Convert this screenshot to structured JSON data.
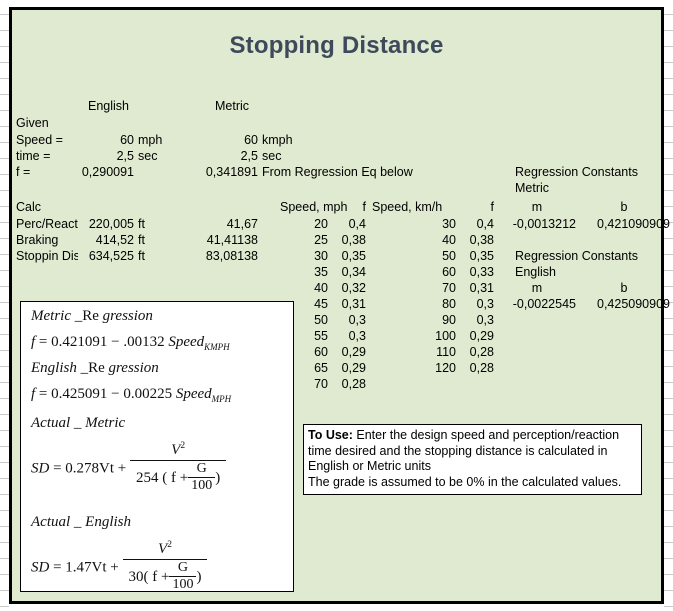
{
  "title": "Stopping Distance",
  "colors": {
    "panel_background": "#dfead0",
    "panel_border": "#000000",
    "title_text": "#3e4a5c",
    "box_background": "#ffffff"
  },
  "headers": {
    "english": "English",
    "metric": "Metric"
  },
  "given": {
    "section_label": "Given",
    "rows": [
      {
        "label": "Speed =",
        "english_value": "60",
        "english_unit": "mph",
        "metric_value": "60",
        "metric_unit": "kmph"
      },
      {
        "label": "time =",
        "english_value": "2,5",
        "english_unit": "sec",
        "metric_value": "2,5",
        "metric_unit": "sec"
      },
      {
        "label": "f =",
        "english_value": "0,290091",
        "english_unit": "",
        "metric_value": "0,341891",
        "metric_unit": "From Regression Eq below"
      }
    ]
  },
  "calc": {
    "section_label": "Calc",
    "rows": [
      {
        "label": "Perc/React",
        "english_value": "220,005",
        "english_unit": "ft",
        "metric_value": "41,67"
      },
      {
        "label": "Braking",
        "english_value": "414,52",
        "english_unit": "ft",
        "metric_value": "41,41138"
      },
      {
        "label": "Stoppin Dist",
        "english_value": "634,525",
        "english_unit": "ft",
        "metric_value": "83,08138"
      }
    ]
  },
  "table_mph": {
    "header_speed": "Speed, mph",
    "header_f": "f",
    "rows": [
      {
        "speed": "20",
        "f": "0,4"
      },
      {
        "speed": "25",
        "f": "0,38"
      },
      {
        "speed": "30",
        "f": "0,35"
      },
      {
        "speed": "35",
        "f": "0,34"
      },
      {
        "speed": "40",
        "f": "0,32"
      },
      {
        "speed": "45",
        "f": "0,31"
      },
      {
        "speed": "50",
        "f": "0,3"
      },
      {
        "speed": "55",
        "f": "0,3"
      },
      {
        "speed": "60",
        "f": "0,29"
      },
      {
        "speed": "65",
        "f": "0,29"
      },
      {
        "speed": "70",
        "f": "0,28"
      }
    ]
  },
  "table_kmh": {
    "header_speed": "Speed, km/h",
    "header_f": "f",
    "rows": [
      {
        "speed": "30",
        "f": "0,4"
      },
      {
        "speed": "40",
        "f": "0,38"
      },
      {
        "speed": "50",
        "f": "0,35"
      },
      {
        "speed": "60",
        "f": "0,33"
      },
      {
        "speed": "70",
        "f": "0,31"
      },
      {
        "speed": "80",
        "f": "0,3"
      },
      {
        "speed": "90",
        "f": "0,3"
      },
      {
        "speed": "100",
        "f": "0,29"
      },
      {
        "speed": "110",
        "f": "0,28"
      },
      {
        "speed": "120",
        "f": "0,28"
      }
    ]
  },
  "regression_metric": {
    "title": "Regression Constants",
    "subtitle": "Metric",
    "header_m": "m",
    "header_b": "b",
    "m": "-0,0013212",
    "b": "0,421090909"
  },
  "regression_english": {
    "title": "Regression Constants",
    "subtitle": "English",
    "header_m": "m",
    "header_b": "b",
    "m": "-0,0022545",
    "b": "0,425090909"
  },
  "formulas": {
    "metric_regression_title_italic": "Metric",
    "metric_regression_title_rest": "_Re",
    "metric_regression_title_tail": "gression",
    "metric_regression_eq_lhs": "f",
    "metric_regression_eq_rhs": "= 0.421091 − .00132",
    "metric_regression_eq_var": "Speed",
    "metric_regression_eq_sub": "KMPH",
    "english_regression_title_italic": "English",
    "english_regression_title_rest": "_Re",
    "english_regression_title_tail": "gression",
    "english_regression_eq_lhs": "f",
    "english_regression_eq_rhs": "= 0.425091 − 0.00225",
    "english_regression_eq_var": "Speed",
    "english_regression_eq_sub": "MPH",
    "actual_metric_title_a": "Actual",
    "actual_metric_title_b": "_",
    "actual_metric_title_c": "Metric",
    "actual_metric_sd": "SD",
    "actual_metric_eq": "= 0.278Vt +",
    "actual_metric_num": "V",
    "actual_metric_num_sup": "2",
    "actual_metric_den_pre": "254 ( f +",
    "actual_metric_den_frac_num": "G",
    "actual_metric_den_frac_den": "100",
    "actual_metric_den_post": ")",
    "actual_english_title_a": "Actual",
    "actual_english_title_b": "_",
    "actual_english_title_c": "English",
    "actual_english_sd": "SD",
    "actual_english_eq": "= 1.47Vt +",
    "actual_english_num": "V",
    "actual_english_num_sup": "2",
    "actual_english_den_pre": "30( f +",
    "actual_english_den_frac_num": "G",
    "actual_english_den_frac_den": "100",
    "actual_english_den_post": ")"
  },
  "to_use": {
    "bold_prefix": "To Use:",
    "line1": " Enter the design speed and perception/reaction",
    "line2": "time desired and the stopping distance is calculated in",
    "line3": "English or Metric units",
    "line4": "The grade is assumed to be 0% in the calculated values."
  }
}
